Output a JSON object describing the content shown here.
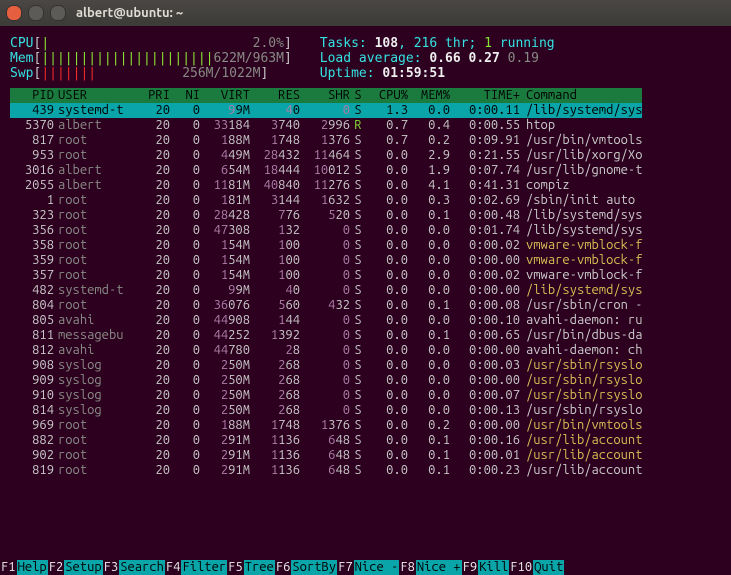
{
  "window": {
    "title": "albert@ubuntu: ~"
  },
  "meters": {
    "cpu": {
      "label": "CPU",
      "bar": "[|                          2.0%]"
    },
    "mem": {
      "label": "Mem",
      "bar": "[||||||||||||||||||||||622M/963M]"
    },
    "swp": {
      "label": "Swp",
      "bar": "[|||||||           256M/1022M]"
    }
  },
  "stats": {
    "tasks_label": "Tasks: ",
    "tasks": "108",
    "thr": ", 216 thr; ",
    "running": "1",
    "running_label": " running",
    "load_label": "Load average: ",
    "load1": "0.66",
    "load2": "0.27",
    "load3": "0.19",
    "uptime_label": "Uptime: ",
    "uptime": "01:59:51"
  },
  "columns": [
    "PID",
    "USER",
    "PRI",
    "NI",
    "VIRT",
    "RES",
    "SHR",
    "S",
    "CPU%",
    "MEM%",
    "TIME+",
    "Command"
  ],
  "selected_index": 0,
  "processes": [
    {
      "pid": "439",
      "user": "systemd-t",
      "pri": "20",
      "ni": "0",
      "virt": "99M",
      "res": "40",
      "shr": "0",
      "s": "S",
      "cpu": "1.3",
      "mem": "0.0",
      "time": "0:00.11",
      "cmd": "/lib/systemd/sys",
      "cmd_color": "green"
    },
    {
      "pid": "5370",
      "user": "albert",
      "pri": "20",
      "ni": "0",
      "virt": "33184",
      "res": "3740",
      "shr": "2996",
      "s": "R",
      "cpu": "0.7",
      "mem": "0.4",
      "time": "0:00.55",
      "cmd": "htop",
      "s_color": "green"
    },
    {
      "pid": "817",
      "user": "root",
      "pri": "20",
      "ni": "0",
      "virt": "188M",
      "res": "1748",
      "shr": "1376",
      "s": "S",
      "cpu": "0.7",
      "mem": "0.2",
      "time": "0:09.91",
      "cmd": "/usr/bin/vmtools"
    },
    {
      "pid": "953",
      "user": "root",
      "pri": "20",
      "ni": "0",
      "virt": "449M",
      "res": "28432",
      "shr": "11464",
      "s": "S",
      "cpu": "0.0",
      "mem": "2.9",
      "time": "0:21.55",
      "cmd": "/usr/lib/xorg/Xo"
    },
    {
      "pid": "3016",
      "user": "albert",
      "pri": "20",
      "ni": "0",
      "virt": "654M",
      "res": "18444",
      "shr": "10012",
      "s": "S",
      "cpu": "0.0",
      "mem": "1.9",
      "time": "0:07.74",
      "cmd": "/usr/lib/gnome-t"
    },
    {
      "pid": "2055",
      "user": "albert",
      "pri": "20",
      "ni": "0",
      "virt": "1181M",
      "res": "40840",
      "shr": "11276",
      "s": "S",
      "cpu": "0.0",
      "mem": "4.1",
      "time": "0:41.31",
      "cmd": "compiz"
    },
    {
      "pid": "1",
      "user": "root",
      "pri": "20",
      "ni": "0",
      "virt": "181M",
      "res": "3144",
      "shr": "1632",
      "s": "S",
      "cpu": "0.0",
      "mem": "0.3",
      "time": "0:02.69",
      "cmd": "/sbin/init auto"
    },
    {
      "pid": "323",
      "user": "root",
      "pri": "20",
      "ni": "0",
      "virt": "28428",
      "res": "776",
      "shr": "520",
      "s": "S",
      "cpu": "0.0",
      "mem": "0.1",
      "time": "0:00.48",
      "cmd": "/lib/systemd/sys"
    },
    {
      "pid": "356",
      "user": "root",
      "pri": "20",
      "ni": "0",
      "virt": "47308",
      "res": "132",
      "shr": "0",
      "s": "S",
      "cpu": "0.0",
      "mem": "0.0",
      "time": "0:01.74",
      "cmd": "/lib/systemd/sys"
    },
    {
      "pid": "358",
      "user": "root",
      "pri": "20",
      "ni": "0",
      "virt": "154M",
      "res": "100",
      "shr": "0",
      "s": "S",
      "cpu": "0.0",
      "mem": "0.0",
      "time": "0:00.02",
      "cmd": "vmware-vmblock-f",
      "cmd_color": "orange"
    },
    {
      "pid": "359",
      "user": "root",
      "pri": "20",
      "ni": "0",
      "virt": "154M",
      "res": "100",
      "shr": "0",
      "s": "S",
      "cpu": "0.0",
      "mem": "0.0",
      "time": "0:00.00",
      "cmd": "vmware-vmblock-f",
      "cmd_color": "orange"
    },
    {
      "pid": "357",
      "user": "root",
      "pri": "20",
      "ni": "0",
      "virt": "154M",
      "res": "100",
      "shr": "0",
      "s": "S",
      "cpu": "0.0",
      "mem": "0.0",
      "time": "0:00.02",
      "cmd": "vmware-vmblock-f"
    },
    {
      "pid": "482",
      "user": "systemd-t",
      "pri": "20",
      "ni": "0",
      "virt": "99M",
      "res": "40",
      "shr": "0",
      "s": "S",
      "cpu": "0.0",
      "mem": "0.0",
      "time": "0:00.00",
      "cmd": "/lib/systemd/sys",
      "cmd_color": "orange"
    },
    {
      "pid": "804",
      "user": "root",
      "pri": "20",
      "ni": "0",
      "virt": "36076",
      "res": "560",
      "shr": "432",
      "s": "S",
      "cpu": "0.0",
      "mem": "0.1",
      "time": "0:00.08",
      "cmd": "/usr/sbin/cron -"
    },
    {
      "pid": "805",
      "user": "avahi",
      "pri": "20",
      "ni": "0",
      "virt": "44908",
      "res": "144",
      "shr": "0",
      "s": "S",
      "cpu": "0.0",
      "mem": "0.0",
      "time": "0:00.10",
      "cmd": "avahi-daemon: ru"
    },
    {
      "pid": "811",
      "user": "messagebu",
      "pri": "20",
      "ni": "0",
      "virt": "44252",
      "res": "1392",
      "shr": "0",
      "s": "S",
      "cpu": "0.0",
      "mem": "0.1",
      "time": "0:00.65",
      "cmd": "/usr/bin/dbus-da"
    },
    {
      "pid": "812",
      "user": "avahi",
      "pri": "20",
      "ni": "0",
      "virt": "44780",
      "res": "28",
      "shr": "0",
      "s": "S",
      "cpu": "0.0",
      "mem": "0.0",
      "time": "0:00.00",
      "cmd": "avahi-daemon: ch"
    },
    {
      "pid": "908",
      "user": "syslog",
      "pri": "20",
      "ni": "0",
      "virt": "250M",
      "res": "268",
      "shr": "0",
      "s": "S",
      "cpu": "0.0",
      "mem": "0.0",
      "time": "0:00.03",
      "cmd": "/usr/sbin/rsyslo",
      "cmd_color": "orange"
    },
    {
      "pid": "909",
      "user": "syslog",
      "pri": "20",
      "ni": "0",
      "virt": "250M",
      "res": "268",
      "shr": "0",
      "s": "S",
      "cpu": "0.0",
      "mem": "0.0",
      "time": "0:00.00",
      "cmd": "/usr/sbin/rsyslo",
      "cmd_color": "orange"
    },
    {
      "pid": "910",
      "user": "syslog",
      "pri": "20",
      "ni": "0",
      "virt": "250M",
      "res": "268",
      "shr": "0",
      "s": "S",
      "cpu": "0.0",
      "mem": "0.0",
      "time": "0:00.07",
      "cmd": "/usr/sbin/rsyslo",
      "cmd_color": "orange"
    },
    {
      "pid": "814",
      "user": "syslog",
      "pri": "20",
      "ni": "0",
      "virt": "250M",
      "res": "268",
      "shr": "0",
      "s": "S",
      "cpu": "0.0",
      "mem": "0.0",
      "time": "0:00.13",
      "cmd": "/usr/sbin/rsyslo"
    },
    {
      "pid": "969",
      "user": "root",
      "pri": "20",
      "ni": "0",
      "virt": "188M",
      "res": "1748",
      "shr": "1376",
      "s": "S",
      "cpu": "0.0",
      "mem": "0.2",
      "time": "0:00.00",
      "cmd": "/usr/bin/vmtools",
      "cmd_color": "orange"
    },
    {
      "pid": "882",
      "user": "root",
      "pri": "20",
      "ni": "0",
      "virt": "291M",
      "res": "1136",
      "shr": "648",
      "s": "S",
      "cpu": "0.0",
      "mem": "0.1",
      "time": "0:00.16",
      "cmd": "/usr/lib/account",
      "cmd_color": "orange"
    },
    {
      "pid": "902",
      "user": "root",
      "pri": "20",
      "ni": "0",
      "virt": "291M",
      "res": "1136",
      "shr": "648",
      "s": "S",
      "cpu": "0.0",
      "mem": "0.1",
      "time": "0:00.01",
      "cmd": "/usr/lib/account",
      "cmd_color": "orange"
    },
    {
      "pid": "819",
      "user": "root",
      "pri": "20",
      "ni": "0",
      "virt": "291M",
      "res": "1136",
      "shr": "648",
      "s": "S",
      "cpu": "0.0",
      "mem": "0.1",
      "time": "0:00.23",
      "cmd": "/usr/lib/account"
    }
  ],
  "footer": [
    {
      "key": "F1",
      "label": "Help "
    },
    {
      "key": "F2",
      "label": "Setup "
    },
    {
      "key": "F3",
      "label": "Search"
    },
    {
      "key": "F4",
      "label": "Filter"
    },
    {
      "key": "F5",
      "label": "Tree  "
    },
    {
      "key": "F6",
      "label": "SortBy"
    },
    {
      "key": "F7",
      "label": "Nice -"
    },
    {
      "key": "F8",
      "label": "Nice +"
    },
    {
      "key": "F9",
      "label": "Kill  "
    },
    {
      "key": "F10",
      "label": "Quit  "
    }
  ]
}
